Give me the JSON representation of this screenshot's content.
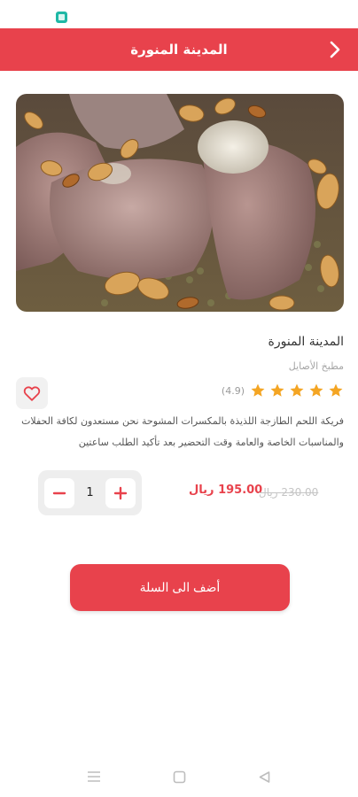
{
  "header": {
    "title": "المدينة المنورة"
  },
  "product": {
    "name": "المدينة المنورة",
    "kitchen": "مطبخ الأصايل",
    "rating": 4.9,
    "rating_text": "(4.9)",
    "stars_total": 5,
    "description": "فريكة اللحم الطازجة اللذيذة بالمكسرات المشوحة نحن مستعدون لكافة الحفلات والمناسبات الخاصة والعامة وقت التحضير بعد تأكيد الطلب ساعتين",
    "price_current": "195.00 ريال",
    "price_old": "230.00 ريال"
  },
  "quantity": {
    "value": "1"
  },
  "actions": {
    "add_to_cart": "أضف الى السلة"
  },
  "colors": {
    "accent": "#e8424c",
    "star": "#f4a523"
  },
  "icons": {
    "back": "chevron-right-icon",
    "favorite": "heart-outline-icon",
    "minus": "minus-icon",
    "plus": "plus-icon",
    "nav_recents": "menu-lines-icon",
    "nav_home": "square-icon",
    "nav_back": "triangle-left-icon"
  }
}
